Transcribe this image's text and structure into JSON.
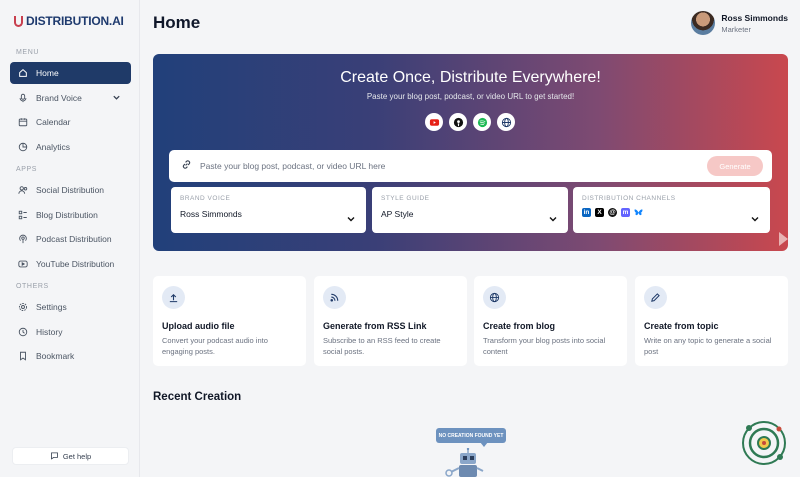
{
  "brand": {
    "logo_text": "DISTRIBUTION.AI"
  },
  "sidebar": {
    "sections": {
      "menu": "MENU",
      "apps": "APPS",
      "others": "OTHERS"
    },
    "items": [
      {
        "label": "Home",
        "icon": "home-icon"
      },
      {
        "label": "Brand Voice",
        "icon": "mic-icon"
      },
      {
        "label": "Calendar",
        "icon": "calendar-icon"
      },
      {
        "label": "Analytics",
        "icon": "analytics-icon"
      },
      {
        "label": "Social Distribution",
        "icon": "social-icon"
      },
      {
        "label": "Blog Distribution",
        "icon": "blog-icon"
      },
      {
        "label": "Podcast Distribution",
        "icon": "podcast-icon"
      },
      {
        "label": "YouTube Distribution",
        "icon": "youtube-icon"
      },
      {
        "label": "Settings",
        "icon": "gear-icon"
      },
      {
        "label": "History",
        "icon": "history-icon"
      },
      {
        "label": "Bookmark",
        "icon": "bookmark-icon"
      }
    ],
    "help_label": "Get help"
  },
  "header": {
    "title": "Home",
    "user_name": "Ross Simmonds",
    "user_role": "Marketer"
  },
  "hero": {
    "title": "Create Once, Distribute Everywhere!",
    "subtitle": "Paste your blog post, podcast, or video URL to get started!",
    "platforms": [
      "youtube-icon",
      "apple-podcasts-icon",
      "spotify-icon",
      "web-icon"
    ],
    "url_placeholder": "Paste your blog post, podcast, or video URL here",
    "generate_label": "Generate",
    "brand_voice": {
      "label": "BRAND VOICE",
      "value": "Ross Simmonds"
    },
    "style_guide": {
      "label": "STYLE GUIDE",
      "value": "AP Style"
    },
    "channels": {
      "label": "DISTRIBUTION CHANNELS",
      "icons": [
        "linkedin-icon",
        "x-icon",
        "threads-icon",
        "mastodon-icon",
        "bluesky-icon"
      ]
    }
  },
  "cards": [
    {
      "title": "Upload audio file",
      "desc": "Convert your podcast audio into engaging posts.",
      "icon": "upload-icon"
    },
    {
      "title": "Generate from RSS Link",
      "desc": "Subscribe to an RSS feed to create social posts.",
      "icon": "rss-icon"
    },
    {
      "title": "Create from blog",
      "desc": "Transform your blog posts into social content",
      "icon": "globe-icon"
    },
    {
      "title": "Create from topic",
      "desc": "Write on any topic to generate a social post",
      "icon": "pencil-icon"
    }
  ],
  "recent": {
    "title": "Recent Creation",
    "empty_text": "NO CREATION FOUND YET"
  },
  "colors": {
    "sidebar_active": "#1f3a68",
    "hero_start": "#21407a",
    "hero_end": "#c9484e",
    "generate_button": "#f6c8c6",
    "card_icon_bg": "#e3eaf5"
  }
}
